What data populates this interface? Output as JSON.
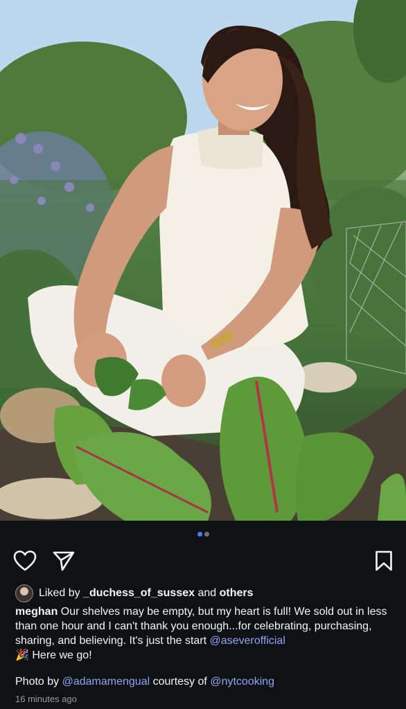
{
  "post": {
    "carousel": {
      "total": 2,
      "active": 1
    },
    "liked_by": {
      "prefix": "Liked by",
      "user": "_duchess_of_sussex",
      "and": "and",
      "others": "others"
    },
    "caption": {
      "username": "meghan",
      "text": "Our shelves may be empty, but my heart is full! We sold out in less than one hour and I can't thank you enough...for celebrating, purchasing, sharing, and believing. It's just the start",
      "mention": "@aseverofficial",
      "emoji": "🎉",
      "tail": "Here we go!"
    },
    "credit": {
      "prefix": "Photo by",
      "photographer": "@adamamengual",
      "middle": "courtesy of",
      "source": "@nytcooking"
    },
    "timestamp": "16 minutes ago"
  },
  "icons": {
    "like": "heart-icon",
    "share": "send-icon",
    "save": "bookmark-icon"
  },
  "colors": {
    "background": "#101114",
    "link": "#8fa6f5",
    "active_dot": "#4a7cf3",
    "inactive_dot": "#6f7278",
    "muted_text": "#9a9ca1"
  }
}
